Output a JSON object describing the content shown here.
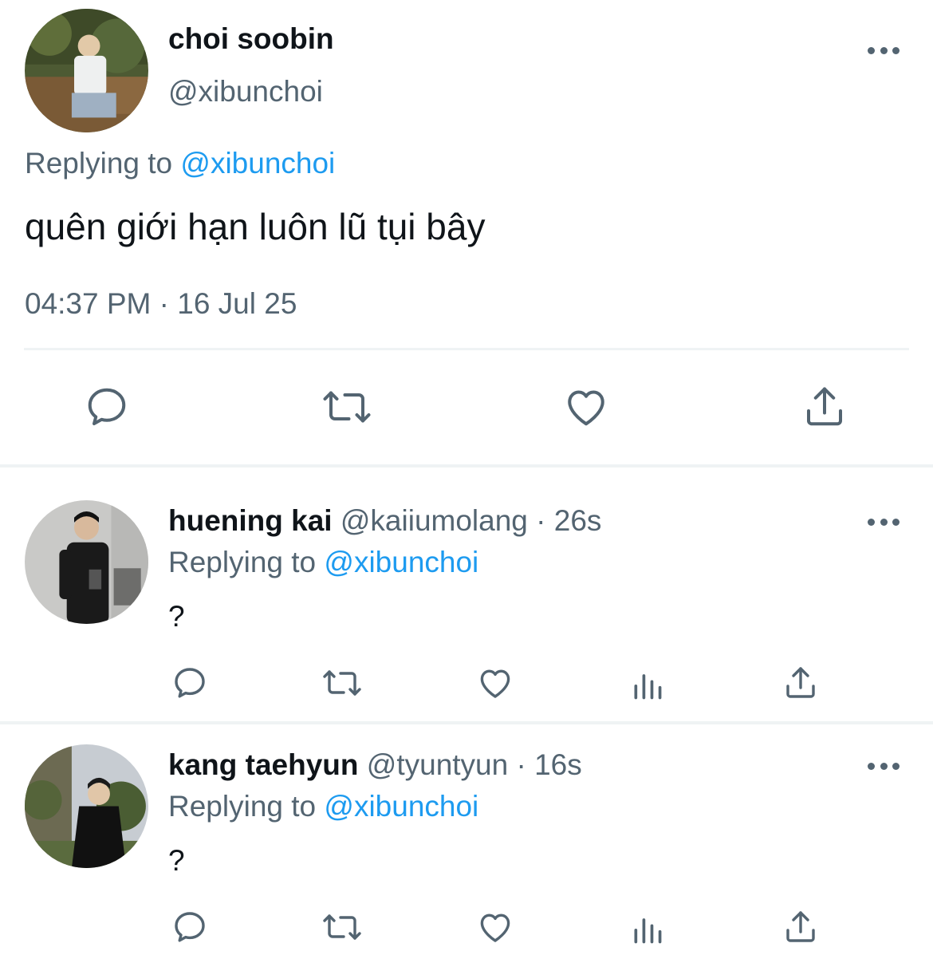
{
  "main_tweet": {
    "display_name": "choi soobin",
    "handle": "@xibunchoi",
    "replying_label": "Replying to",
    "replying_to": "@xibunchoi",
    "text": "quên giới hạn luôn lũ tụi bây",
    "timestamp": "04:37 PM · 16 Jul 25",
    "actions": [
      "reply-icon",
      "retweet-icon",
      "like-icon",
      "share-icon"
    ]
  },
  "replies": [
    {
      "display_name": "huening kai",
      "handle": "@kaiiumolang",
      "separator": "·",
      "time": "26s",
      "replying_label": "Replying to",
      "replying_to": "@xibunchoi",
      "text": "?",
      "actions": [
        "reply-icon",
        "retweet-icon",
        "like-icon",
        "views-icon",
        "share-icon"
      ]
    },
    {
      "display_name": "kang taehyun",
      "handle": "@tyuntyun",
      "separator": "·",
      "time": "16s",
      "replying_label": "Replying to",
      "replying_to": "@xibunchoi",
      "text": "?",
      "actions": [
        "reply-icon",
        "retweet-icon",
        "like-icon",
        "views-icon",
        "share-icon"
      ]
    }
  ],
  "colors": {
    "text_primary": "#0f1419",
    "text_secondary": "#536471",
    "link": "#1d9bf0",
    "divider": "#eff3f4"
  }
}
